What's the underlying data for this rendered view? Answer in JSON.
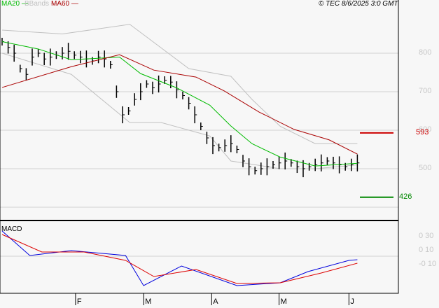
{
  "legend": {
    "ma20": "MA20",
    "bbands": "BBands",
    "ma60": "MA60",
    "ma20_color": "#00bb00",
    "bbands_color": "#c0c0c0",
    "ma60_color": "#aa0000"
  },
  "copyright": "© TEC 8/6/2025 3:0 GMT",
  "macd_label": "MACD",
  "chart_data": {
    "type": "line",
    "title": "Price chart with MA20, Bollinger Bands, MA60 and MACD",
    "price_ylim": [
      350,
      880
    ],
    "price_ticks": [
      {
        "v": 800,
        "label": "800"
      },
      {
        "v": 700,
        "label": "700"
      },
      {
        "v": 600,
        "label": "600"
      },
      {
        "v": 500,
        "label": "500"
      },
      {
        "v": 400,
        "label": ""
      }
    ],
    "resistance": {
      "value": 593,
      "label": "593",
      "color": "#cc0000"
    },
    "support": {
      "value": 426,
      "label": "426",
      "color": "#008800"
    },
    "x_ticks": [
      {
        "i": 12.2,
        "label": "F"
      },
      {
        "i": 23.5,
        "label": "M"
      },
      {
        "i": 34.8,
        "label": "A"
      },
      {
        "i": 46,
        "label": "M"
      },
      {
        "i": 57.6,
        "label": "J"
      }
    ],
    "closes": [
      830,
      815,
      800,
      760,
      745,
      790,
      800,
      785,
      790,
      795,
      800,
      805,
      795,
      790,
      785,
      780,
      790,
      785,
      770,
      700,
      640,
      650,
      680,
      700,
      720,
      710,
      720,
      730,
      725,
      705,
      690,
      670,
      640,
      610,
      580,
      560,
      555,
      560,
      565,
      550,
      520,
      505,
      495,
      500,
      505,
      510,
      515,
      520,
      515,
      505,
      500,
      505,
      510,
      515,
      520,
      515,
      510,
      505,
      510,
      515
    ],
    "ma20_points": [
      [
        0,
        830
      ],
      [
        6,
        811
      ],
      [
        11.5,
        783
      ],
      [
        19.5,
        790
      ],
      [
        23,
        747
      ],
      [
        29,
        710
      ],
      [
        34.5,
        665
      ],
      [
        38,
        611
      ],
      [
        41.5,
        565
      ],
      [
        46.2,
        530
      ],
      [
        52,
        507
      ],
      [
        59,
        514
      ]
    ],
    "ma60_points": [
      [
        0,
        711
      ],
      [
        11.5,
        765
      ],
      [
        19.5,
        796
      ],
      [
        25.2,
        756
      ],
      [
        32.2,
        738
      ],
      [
        36.9,
        702
      ],
      [
        42.7,
        647
      ],
      [
        48.5,
        602
      ],
      [
        54.3,
        575
      ],
      [
        59,
        538
      ]
    ],
    "bb_upper_points": [
      [
        0,
        860
      ],
      [
        10,
        850
      ],
      [
        21.2,
        875
      ],
      [
        31,
        760
      ],
      [
        38,
        740
      ],
      [
        41.5,
        680
      ],
      [
        46.2,
        610
      ],
      [
        52,
        565
      ],
      [
        59,
        565
      ]
    ],
    "bb_lower_points": [
      [
        0,
        800
      ],
      [
        11.5,
        745
      ],
      [
        21.2,
        620
      ],
      [
        26.4,
        620
      ],
      [
        34.5,
        585
      ],
      [
        38,
        520
      ],
      [
        46.2,
        500
      ],
      [
        52,
        500
      ],
      [
        59,
        510
      ]
    ],
    "macd_ylim": [
      -0.5,
      0.7
    ],
    "macd_ticks": [
      {
        "v": 0.3,
        "label": "0 30"
      },
      {
        "v": 0.1,
        "label": "0 10"
      },
      {
        "v": -0.1,
        "label": "-0 10"
      }
    ],
    "macd_points": [
      [
        0,
        0.4
      ],
      [
        4.6,
        0.05
      ],
      [
        11.5,
        0.12
      ],
      [
        20.5,
        0.05
      ],
      [
        23.5,
        -0.38
      ],
      [
        29.8,
        -0.1
      ],
      [
        39,
        -0.38
      ],
      [
        46.2,
        -0.34
      ],
      [
        50.8,
        -0.18
      ],
      [
        57.6,
        -0.02
      ],
      [
        59,
        -0.01
      ]
    ],
    "signal_points": [
      [
        0,
        0.35
      ],
      [
        6.6,
        0.1
      ],
      [
        13.6,
        0.1
      ],
      [
        20.5,
        -0.02
      ],
      [
        25.2,
        -0.25
      ],
      [
        32.2,
        -0.15
      ],
      [
        39,
        -0.35
      ],
      [
        46.2,
        -0.34
      ],
      [
        53,
        -0.2
      ],
      [
        59,
        -0.06
      ]
    ]
  }
}
